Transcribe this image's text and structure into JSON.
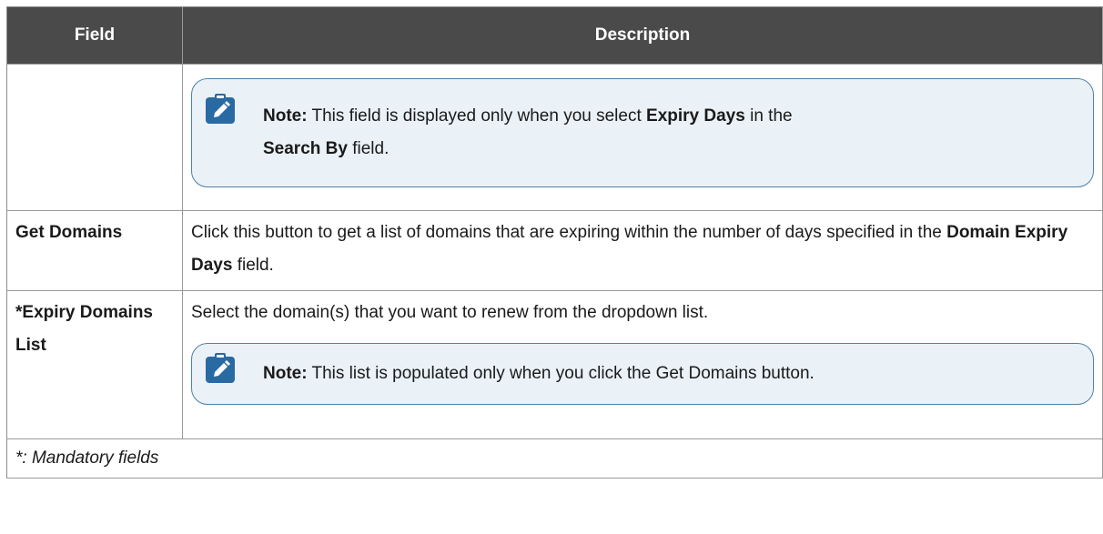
{
  "table": {
    "headers": [
      "Field",
      "Description"
    ],
    "row1": {
      "field": "",
      "note": {
        "label": "Note:",
        "text_1": " This field is displayed only when you select ",
        "bold_1": "Expiry Days",
        "text_2": " in the ",
        "bold_2": "Search By",
        "text_3": " field."
      }
    },
    "row2": {
      "field": "Get Domains",
      "desc_1": "Click this button to get a list of domains that are expiring within the number of days specified in the ",
      "desc_bold": "Domain Expiry Days",
      "desc_2": " field."
    },
    "row3": {
      "field": "*Expiry Domains List",
      "desc": "Select the domain(s) that you want to renew from the dropdown list.",
      "note": {
        "label": "Note:",
        "text": " This list is populated only when you click the Get Domains button."
      }
    },
    "footer": "*: Mandatory fields"
  },
  "colors": {
    "header_bg": "#4a4a4a",
    "note_bg": "#eaf1f7",
    "note_border": "#4f81a6",
    "icon_blue": "#2a6aa3"
  },
  "icons": {
    "note": "note-pencil-icon"
  }
}
